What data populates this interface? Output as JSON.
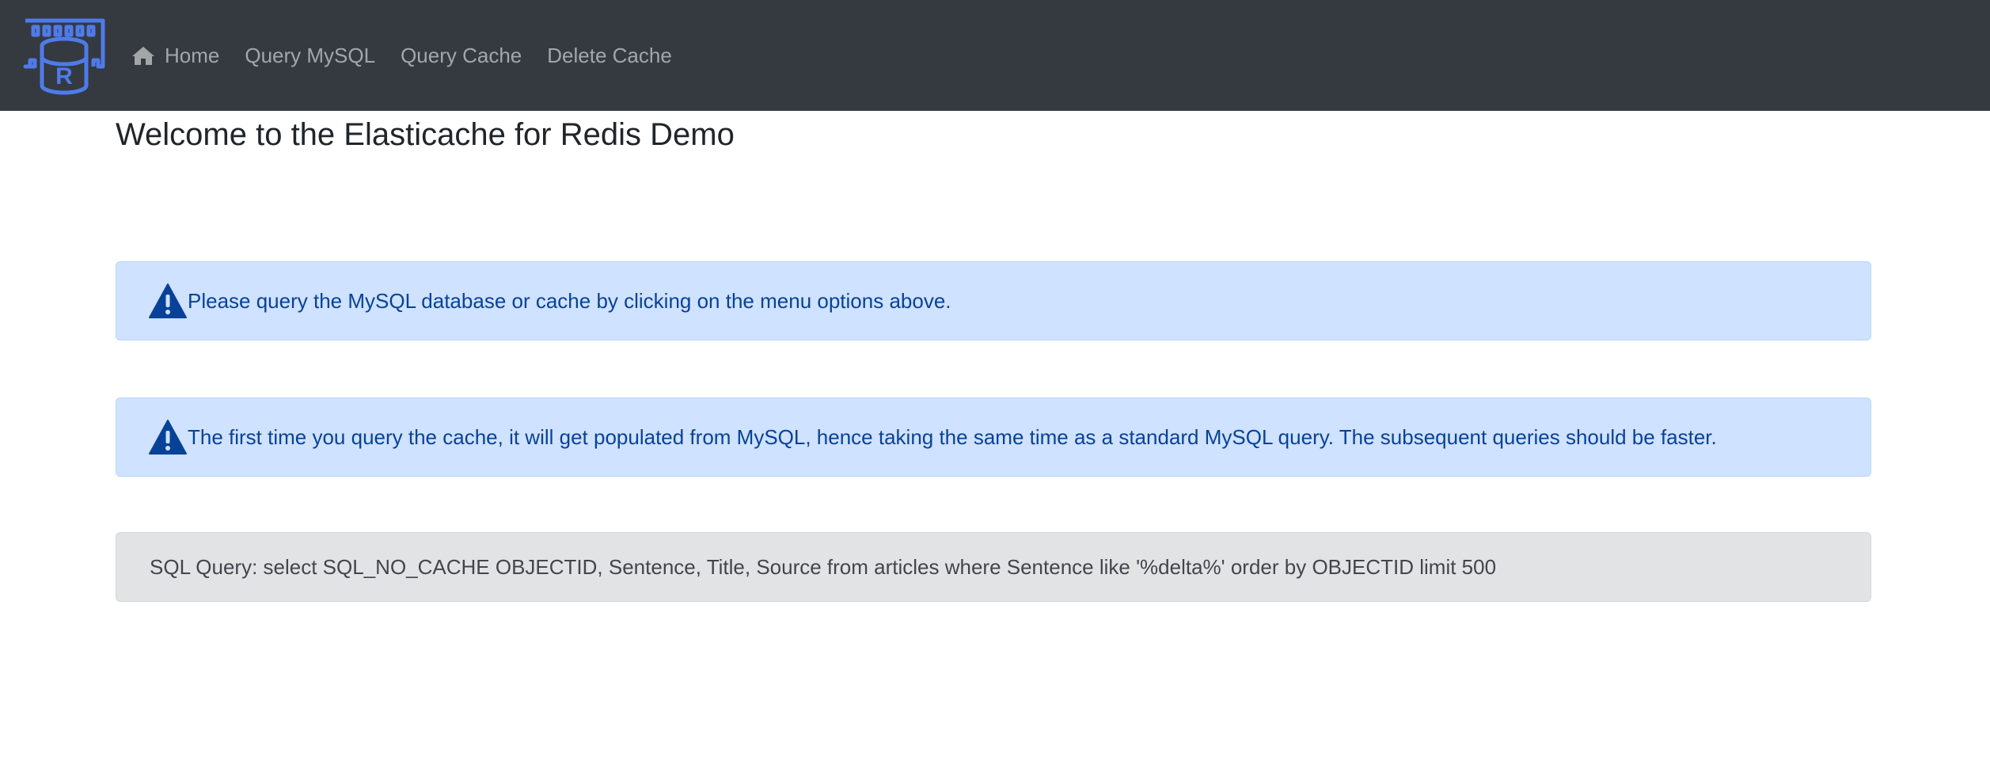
{
  "navbar": {
    "logo_icon": "redis-database-icon",
    "logo_letter": "R",
    "home_icon": "home-icon",
    "items": [
      {
        "label": "Home"
      },
      {
        "label": "Query MySQL"
      },
      {
        "label": "Query Cache"
      },
      {
        "label": "Delete Cache"
      }
    ]
  },
  "main": {
    "title": "Welcome to the Elasticache for Redis Demo",
    "alerts": [
      {
        "icon": "warning-icon",
        "text": "Please query the MySQL database or cache by clicking on the menu options above."
      },
      {
        "icon": "warning-icon",
        "text": "The first time you query the cache, it will get populated from MySQL, hence taking the same time as a standard MySQL query. The subsequent queries should be faster."
      }
    ],
    "sql_query": "SQL Query: select SQL_NO_CACHE OBJECTID, Sentence, Title, Source from articles where Sentence like '%delta%' order by OBJECTID limit 500"
  },
  "colors": {
    "navbar_bg": "#343a40",
    "logo_blue": "#4f7bea",
    "alert_info_bg": "#cfe2ff",
    "alert_info_text": "#084298",
    "alert_secondary_bg": "#e2e3e5"
  }
}
